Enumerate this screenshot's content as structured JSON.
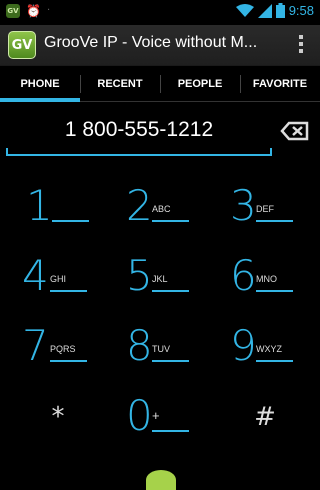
{
  "status_bar": {
    "gv_badge": "GV",
    "time": "9:58",
    "icons": [
      "gv-notification-icon",
      "alarm-icon",
      "wifi-icon",
      "signal-icon",
      "battery-icon"
    ]
  },
  "action_bar": {
    "app_icon_text": "GV",
    "title": "GrooVe IP - Voice without M...",
    "overflow_icon": "overflow-menu-icon"
  },
  "tabs": [
    {
      "label": "PHONE",
      "active": true
    },
    {
      "label": "RECENT",
      "active": false
    },
    {
      "label": "PEOPLE",
      "active": false
    },
    {
      "label": "FAVORITE",
      "active": false
    }
  ],
  "dialer": {
    "number": "1 800-555-1212",
    "backspace_icon": "backspace-icon"
  },
  "keypad": {
    "keys": [
      {
        "digit": "1",
        "letters": ""
      },
      {
        "digit": "2",
        "letters": "ABC"
      },
      {
        "digit": "3",
        "letters": "DEF"
      },
      {
        "digit": "4",
        "letters": "GHI"
      },
      {
        "digit": "5",
        "letters": "JKL"
      },
      {
        "digit": "6",
        "letters": "MNO"
      },
      {
        "digit": "7",
        "letters": "PQRS"
      },
      {
        "digit": "8",
        "letters": "TUV"
      },
      {
        "digit": "9",
        "letters": "WXYZ"
      },
      {
        "digit": "0",
        "letters": "+"
      }
    ],
    "star": "*",
    "pound": "#"
  },
  "colors": {
    "accent": "#33b5e5",
    "background": "#000000",
    "app_green": "#6aa82e"
  }
}
